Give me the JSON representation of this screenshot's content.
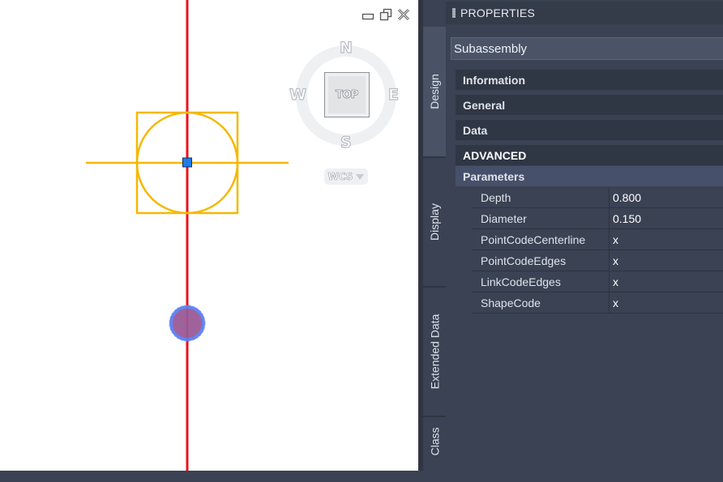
{
  "viewport": {
    "viewcube": {
      "compass": {
        "north": "N",
        "south": "S",
        "east": "E",
        "west": "W"
      },
      "face": "TOP",
      "ucs": "WCS"
    },
    "colors": {
      "axis_line": "#e8141c",
      "subassembly": "#f5b800",
      "grip": "#1e7ee8",
      "marker_fill": "#9a5a96",
      "marker_ring": "#5c7ef0"
    }
  },
  "palette": {
    "title": "PROPERTIES",
    "selected_type": "Subassembly",
    "vertical_tabs": [
      "Design",
      "Display",
      "Extended Data",
      "Class"
    ],
    "sections": {
      "information": "Information",
      "general": "General",
      "data": "Data",
      "advanced": "ADVANCED",
      "parameters": "Parameters"
    },
    "parameters": [
      {
        "name": "Depth",
        "value": "0.800"
      },
      {
        "name": "Diameter",
        "value": "0.150"
      },
      {
        "name": "PointCodeCenterline",
        "value": "x"
      },
      {
        "name": "PointCodeEdges",
        "value": "x"
      },
      {
        "name": "LinkCodeEdges",
        "value": "x"
      },
      {
        "name": "ShapeCode",
        "value": "x"
      }
    ]
  }
}
